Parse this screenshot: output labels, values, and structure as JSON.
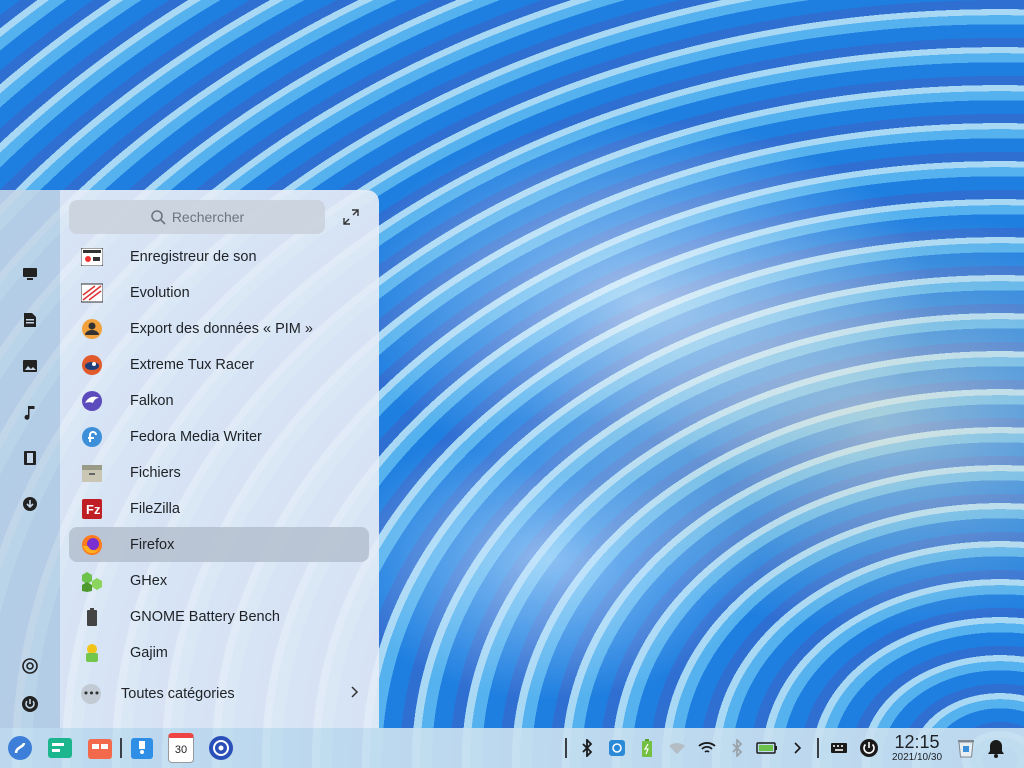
{
  "launcher": {
    "search_placeholder": "Rechercher",
    "apps": [
      {
        "label": "Enregistreur de son",
        "icon": "sound-recorder-icon"
      },
      {
        "label": "Evolution",
        "icon": "evolution-icon"
      },
      {
        "label": "Export des données « PIM »",
        "icon": "pim-export-icon"
      },
      {
        "label": "Extreme Tux Racer",
        "icon": "tux-racer-icon"
      },
      {
        "label": "Falkon",
        "icon": "falkon-icon"
      },
      {
        "label": "Fedora Media Writer",
        "icon": "fedora-media-writer-icon"
      },
      {
        "label": "Fichiers",
        "icon": "files-icon"
      },
      {
        "label": "FileZilla",
        "icon": "filezilla-icon"
      },
      {
        "label": "Firefox",
        "icon": "firefox-icon"
      },
      {
        "label": "GHex",
        "icon": "ghex-icon"
      },
      {
        "label": "GNOME Battery Bench",
        "icon": "battery-bench-icon"
      },
      {
        "label": "Gajim",
        "icon": "gajim-icon"
      }
    ],
    "selected_app": "Firefox",
    "all_categories_label": "Toutes catégories",
    "sidebar_icons": [
      "computer-icon",
      "documents-icon",
      "pictures-icon",
      "music-icon",
      "videos-icon",
      "downloads-icon",
      "settings-icon",
      "power-icon"
    ]
  },
  "taskbar": {
    "calendar_day": "30",
    "time": "12:15",
    "date": "2021/10/30"
  },
  "colors": {
    "accent": "#1a73e8",
    "launcher_bg": "#e4ecf6",
    "taskbar_bg": "#c8e0f0"
  }
}
